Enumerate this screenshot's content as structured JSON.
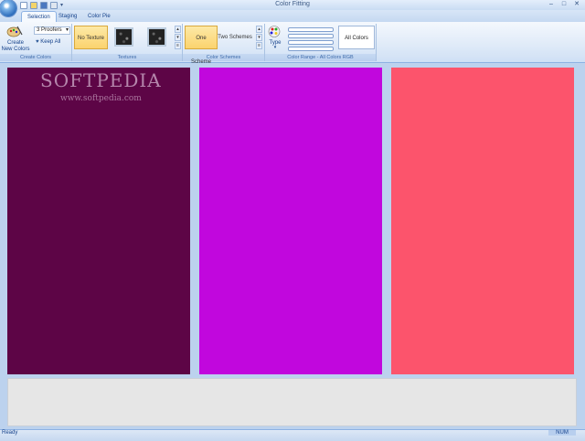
{
  "window": {
    "title": "Color Fitting"
  },
  "tabs": [
    {
      "label": "Selection",
      "active": true
    },
    {
      "label": "Staging",
      "active": false
    },
    {
      "label": "Color Pie",
      "active": false
    }
  ],
  "create_colors": {
    "create_button": "Create\nNew Colors",
    "proofers_select": "3 Proofers",
    "keep_all": "Keep All",
    "group_label": "Create Colors"
  },
  "textures": {
    "no_texture": "No Texture",
    "group_label": "Textures"
  },
  "color_schemes": {
    "one_scheme": "One Scheme",
    "two_schemes": "Two Schemes",
    "group_label": "Color Schemes"
  },
  "color_range": {
    "type_label": "Type",
    "all_colors": "All Colors",
    "group_label": "Color Range - All Colors RGB"
  },
  "panels": [
    {
      "color": "#5d0546"
    },
    {
      "color": "#c107dd"
    },
    {
      "color": "#fc546c"
    }
  ],
  "watermark": {
    "text": "SOFTPEDIA",
    "sub": "www.softpedia.com"
  },
  "status": {
    "text": "Ready",
    "num": "NUM"
  }
}
